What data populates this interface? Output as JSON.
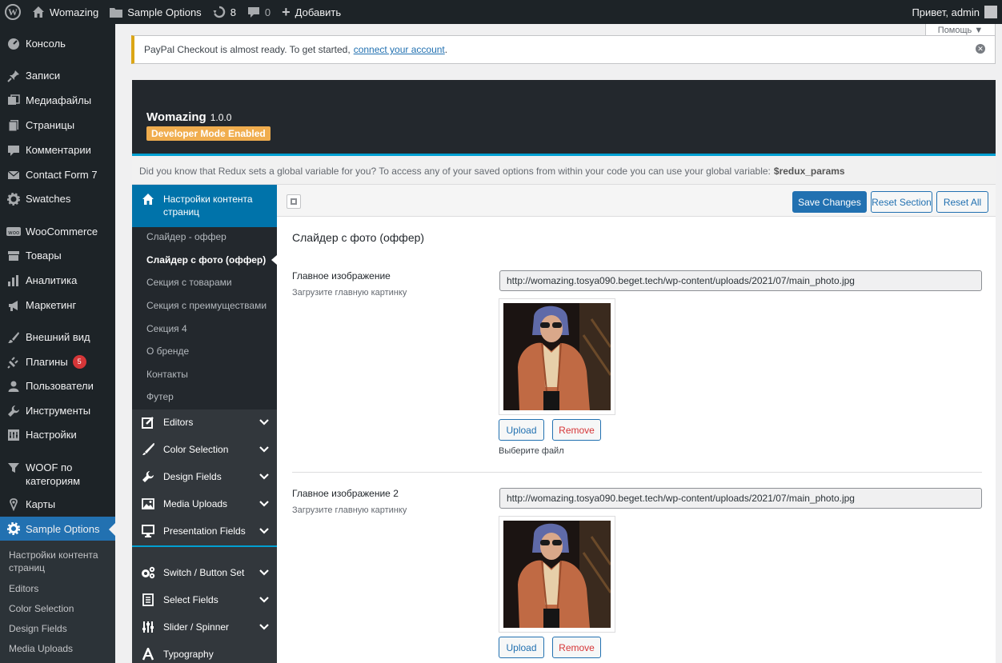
{
  "adminbar": {
    "site_name": "Womazing",
    "theme_options": "Sample Options",
    "updates_count": "8",
    "comments_count": "0",
    "new_label": "Добавить",
    "greeting": "Привет, admin",
    "help_label": "Помощь ▼"
  },
  "menu": {
    "items": [
      {
        "label": "Консоль",
        "icon": "dashboard-icon"
      },
      {
        "label": "Записи",
        "icon": "pin-icon"
      },
      {
        "label": "Медиафайлы",
        "icon": "media-icon"
      },
      {
        "label": "Страницы",
        "icon": "pages-icon"
      },
      {
        "label": "Комментарии",
        "icon": "comment-icon"
      },
      {
        "label": "Contact Form 7",
        "icon": "mail-icon"
      },
      {
        "label": "Swatches",
        "icon": "gear-icon"
      },
      {
        "label": "WooCommerce",
        "icon": "woo-icon"
      },
      {
        "label": "Товары",
        "icon": "archive-icon"
      },
      {
        "label": "Аналитика",
        "icon": "chart-icon"
      },
      {
        "label": "Маркетинг",
        "icon": "megaphone-icon"
      },
      {
        "label": "Внешний вид",
        "icon": "brush-icon"
      },
      {
        "label": "Плагины",
        "icon": "plugin-icon",
        "badge": "5"
      },
      {
        "label": "Пользователи",
        "icon": "user-icon"
      },
      {
        "label": "Инструменты",
        "icon": "wrench-icon"
      },
      {
        "label": "Настройки",
        "icon": "settings-icon"
      },
      {
        "label": "WOOF по категориям",
        "icon": "filter-icon"
      },
      {
        "label": "Карты",
        "icon": "map-icon"
      },
      {
        "label": "Sample Options",
        "icon": "gear-icon"
      }
    ],
    "submenu": [
      "Настройки контента страниц",
      "Editors",
      "Color Selection",
      "Design Fields",
      "Media Uploads"
    ]
  },
  "notice": {
    "text": "PayPal Checkout is almost ready. To get started,",
    "link": "connect your account",
    "tail": "."
  },
  "redux": {
    "title": "Womazing",
    "version": "1.0.0",
    "dev_mode": "Developer Mode Enabled",
    "intro": "Did you know that Redux sets a global variable for you? To access any of your saved options from within your code you can use your global variable:",
    "intro_var": "$redux_params",
    "active_section": "Настройки контента страниц",
    "subsections": [
      "Слайдер - оффер",
      "Слайдер с фото (оффер)",
      "Секция с товарами",
      "Секция с преимуществами",
      "Секция 4",
      "О бренде",
      "Контакты",
      "Футер"
    ],
    "groups": [
      {
        "label": "Editors",
        "icon": "edit-icon"
      },
      {
        "label": "Color Selection",
        "icon": "brush-icon"
      },
      {
        "label": "Design Fields",
        "icon": "wrench-icon"
      },
      {
        "label": "Media Uploads",
        "icon": "image-icon"
      },
      {
        "label": "Presentation Fields",
        "icon": "monitor-icon"
      },
      {
        "label": "Switch / Button Set",
        "icon": "cogs-icon"
      },
      {
        "label": "Select Fields",
        "icon": "list-icon"
      },
      {
        "label": "Slider / Spinner",
        "icon": "sliders-icon"
      },
      {
        "label": "Typography",
        "icon": "font-icon"
      }
    ],
    "buttons": {
      "save": "Save Changes",
      "reset_section": "Reset Section",
      "reset_all": "Reset All"
    },
    "section_heading": "Слайдер с фото (оффер)",
    "fields": [
      {
        "title": "Главное изображение",
        "desc": "Загрузите главную картинку",
        "url": "http://womazing.tosya090.beget.tech/wp-content/uploads/2021/07/main_photo.jpg",
        "upload": "Upload",
        "remove": "Remove",
        "choose": "Выберите файл"
      },
      {
        "title": "Главное изображение 2",
        "desc": "Загрузите главную картинку",
        "url": "http://womazing.tosya090.beget.tech/wp-content/uploads/2021/07/main_photo.jpg",
        "upload": "Upload",
        "remove": "Remove"
      }
    ]
  },
  "colors": {
    "adminbar": "#1d2327",
    "accent": "#2271b1",
    "redux_active": "#0073aa",
    "dev_badge": "#f0ad4e",
    "notice_border": "#dba617"
  }
}
